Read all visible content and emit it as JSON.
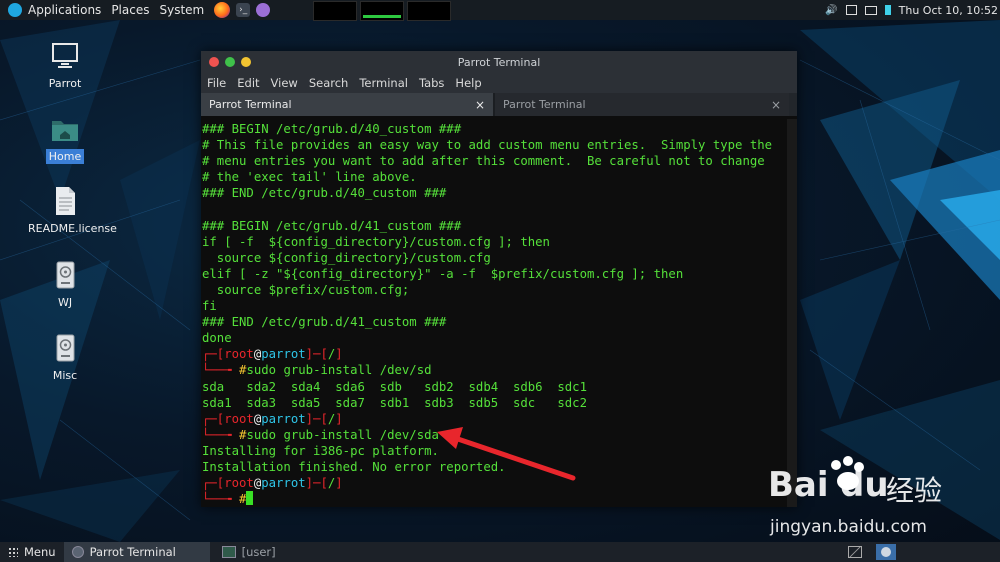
{
  "top_panel": {
    "applications": "Applications",
    "places": "Places",
    "system": "System",
    "clock": "Thu Oct 10, 10:52"
  },
  "desktop": {
    "icons": [
      {
        "label": "Parrot"
      },
      {
        "label": "Home"
      },
      {
        "label": "README.license"
      },
      {
        "label": "WJ"
      },
      {
        "label": "Misc"
      }
    ]
  },
  "window": {
    "title": "Parrot Terminal",
    "menu": [
      "File",
      "Edit",
      "View",
      "Search",
      "Terminal",
      "Tabs",
      "Help"
    ],
    "tabs": [
      {
        "label": "Parrot Terminal",
        "close": "×"
      },
      {
        "label": "Parrot Terminal",
        "close": "×"
      }
    ]
  },
  "terminal": {
    "lines": [
      "### BEGIN /etc/grub.d/40_custom ###",
      "# This file provides an easy way to add custom menu entries.  Simply type the",
      "# menu entries you want to add after this comment.  Be careful not to change",
      "# the 'exec tail' line above.",
      "### END /etc/grub.d/40_custom ###",
      "",
      "### BEGIN /etc/grub.d/41_custom ###",
      "if [ -f  ${config_directory}/custom.cfg ]; then",
      "  source ${config_directory}/custom.cfg",
      "elif [ -z \"${config_directory}\" -a -f  $prefix/custom.cfg ]; then",
      "  source $prefix/custom.cfg;",
      "fi",
      "### END /etc/grub.d/41_custom ###",
      "done"
    ],
    "prompt": {
      "open": "┌─[",
      "user": "root",
      "at": "@",
      "host": "parrot",
      "mid": "]─[",
      "dir": "/",
      "close": "]",
      "lead": "└──╼ ",
      "hash": "#"
    },
    "cmd1": "sudo grub-install /dev/sd",
    "completions": [
      "sda   sda2  sda4  sda6  sdb   sdb2  sdb4  sdb6  sdc1",
      "sda1  sda3  sda5  sda7  sdb1  sdb3  sdb5  sdc   sdc2"
    ],
    "cmd2": "sudo grub-install /dev/sda",
    "output": [
      "Installing for i386-pc platform.",
      "Installation finished. No error reported."
    ]
  },
  "bottom_panel": {
    "menu": "Menu",
    "task_active": "Parrot Terminal",
    "task_other": "[user]"
  },
  "watermark": {
    "brand": "Bai",
    "brand2": "du",
    "cn": "经验",
    "url": "jingyan.baidu.com"
  },
  "colors": {
    "terminal_green": "#55e03a",
    "prompt_red": "#e8262c",
    "host_cyan": "#2fc5e8",
    "arrow_red": "#e8262c"
  }
}
